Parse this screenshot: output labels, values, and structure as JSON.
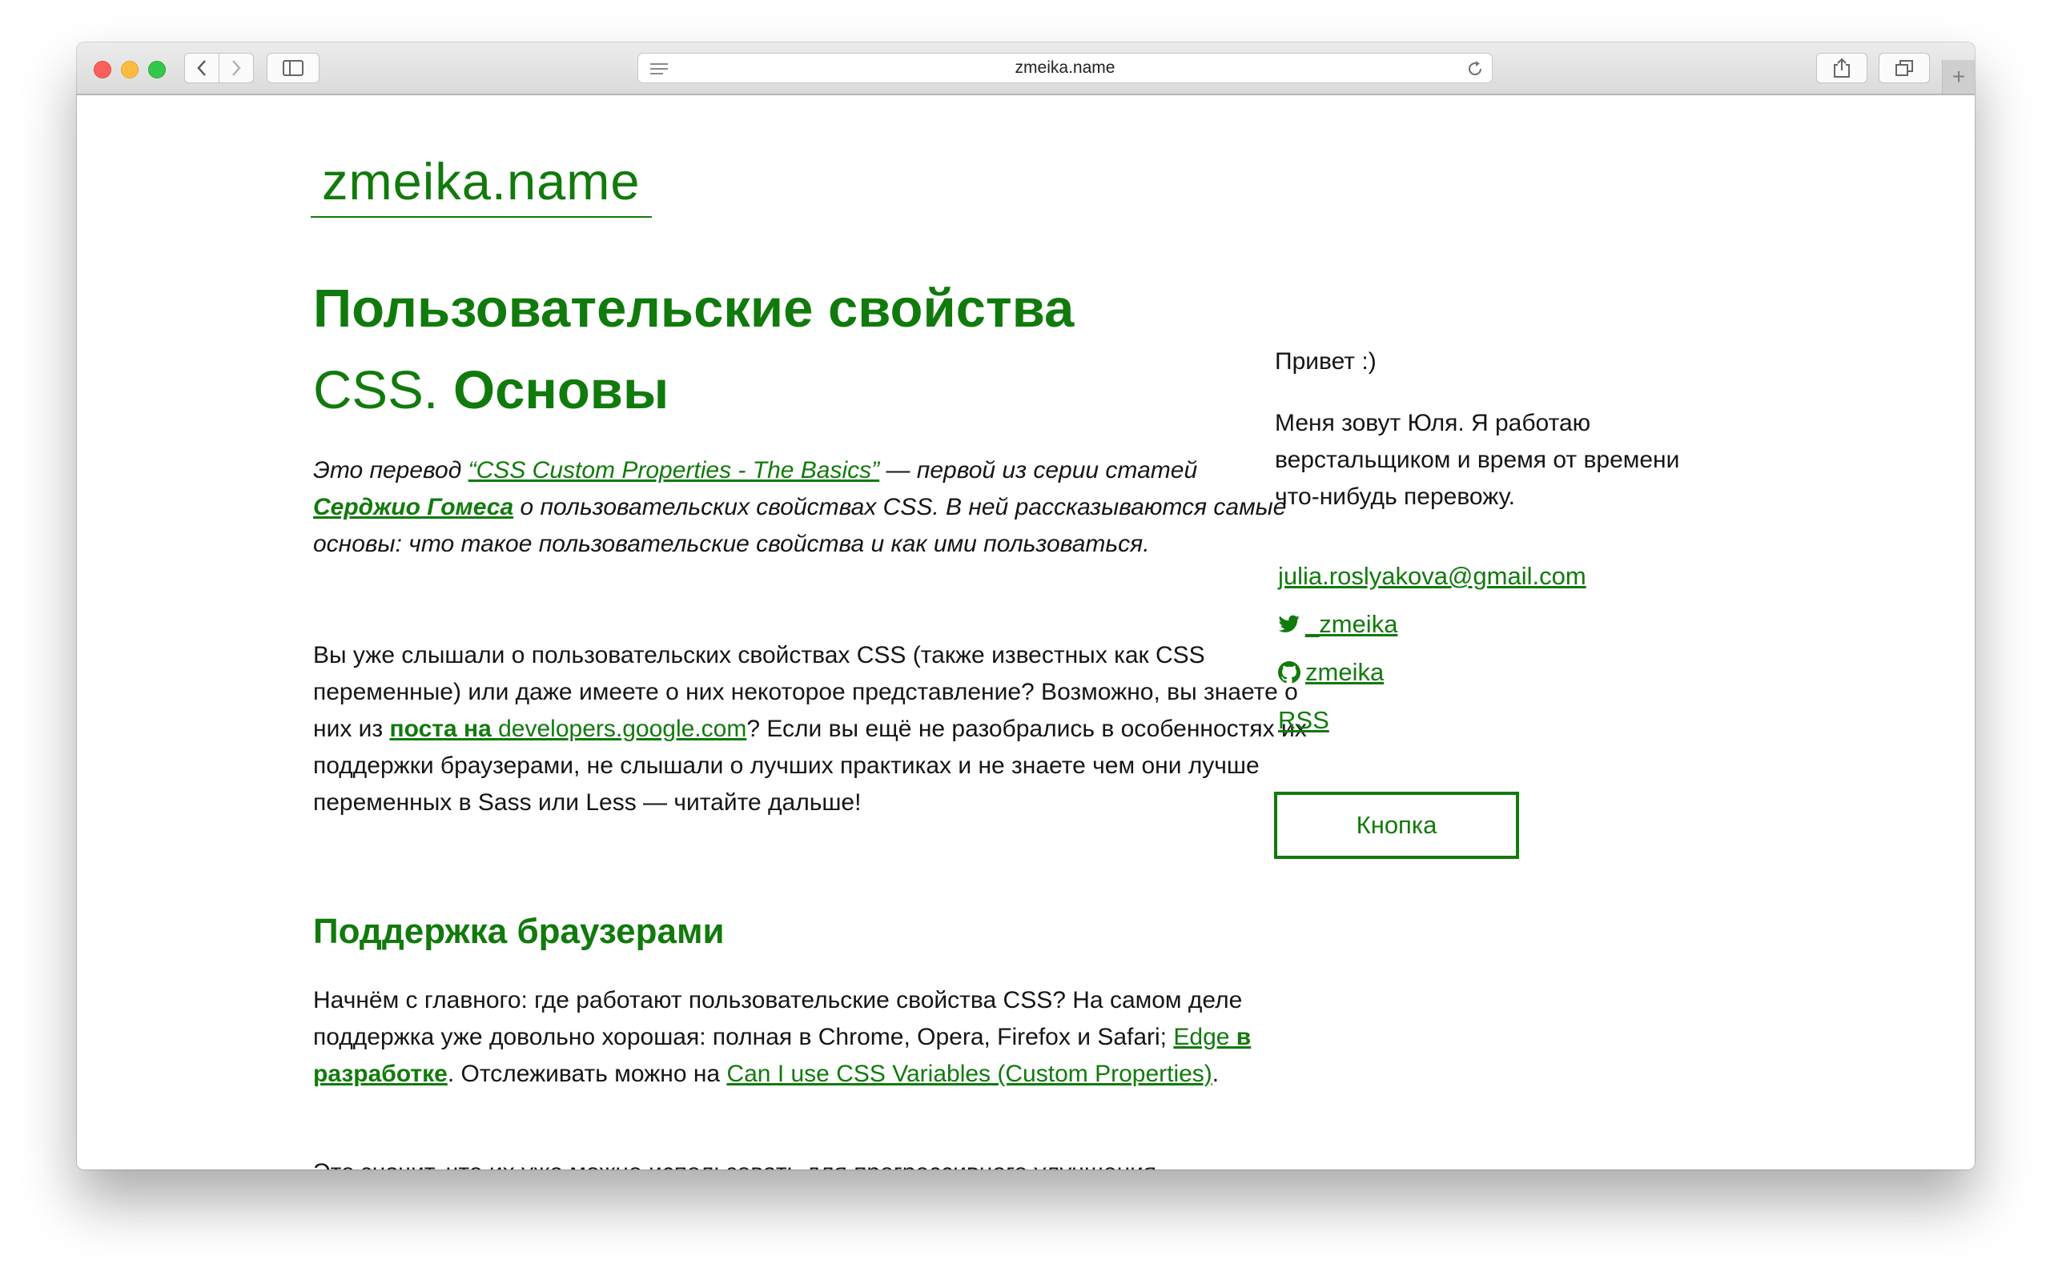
{
  "browser": {
    "url": "zmeika.name"
  },
  "site": {
    "logo": "zmeika.name"
  },
  "article": {
    "title_part1": "Пользовательские свойства",
    "title_css": "CSS.",
    "title_part2": "Основы",
    "intro": {
      "t1": "Это перевод ",
      "link_article": "“CSS Custom Properties - The Basics”",
      "t2": " — первой из серии статей ",
      "link_author": "Серджио Гомеса",
      "t3": " о пользовательских свойствах ",
      "css": "CSS",
      "t4": ". В ней рассказываются самые основы",
      "colon": ":",
      "t5": " что такое пользовательские свойства и как ими пользоваться",
      "dot": "."
    },
    "p1": {
      "t1": "Вы уже слышали о пользовательских свойствах ",
      "css1": "CSS",
      "t2": " (также известных как ",
      "css2": "CSS",
      "t3": " переменные) или даже имеете о них некоторое представление",
      "q1": "?",
      "t4": " Возможно, вы знаете о них из ",
      "link1": "поста на ",
      "link1_domain": "developers.google.com",
      "q2": "?",
      "t5": " Если вы ещё не разобрались в особенностях их поддержки браузерами, не слышали о лучших практиках и не знаете чем они лучше переменных в ",
      "sass": "Sass",
      "t6": " или ",
      "less": "Less",
      "t7": " — читайте дальше",
      "excl": "!"
    },
    "h2": "Поддержка браузерами",
    "p2": {
      "t1": "Начнём с главного",
      "colon1": ":",
      "t2": " где работают пользовательские свойства ",
      "css": "CSS?",
      "t3": " На самом деле поддержка уже довольно хорошая",
      "colon2": ":",
      "t4": " полная в ",
      "browsers": "Chrome, Opera, Firefox",
      "t5": " и ",
      "safari": "Safari;",
      "t6": " ",
      "link_edge": "Edge",
      "link_edge2": " в разработке",
      "t7": ". Отслеживать можно на ",
      "link_caniuse": "Can I use CSS Variables (Custom Properties)",
      "dot": "."
    },
    "p3": "Это значит, что их уже можно использовать для прогрессивного улучшения,"
  },
  "sidebar": {
    "greeting": "Привет :)",
    "about": "Меня зовут Юля. Я работаю верстальщиком и время от времени что-нибудь перевожу.",
    "email": "julia.roslyakova@gmail.com",
    "twitter": "_zmeika",
    "github": "zmeika",
    "rss": "RSS",
    "button": "Кнопка"
  },
  "colors": {
    "accent": "#117a0c",
    "text": "#151515"
  }
}
